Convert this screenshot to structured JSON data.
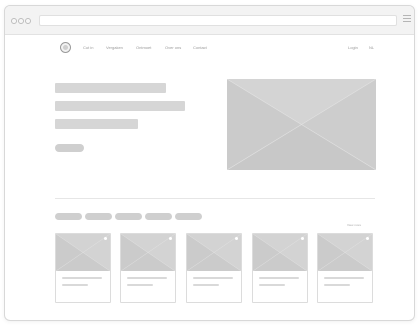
{
  "nav": {
    "items": [
      "Cut in",
      "Vergaken",
      "Ontmoet",
      "Over ons",
      "Contact"
    ],
    "login_label": "Login",
    "lang_label": "NL"
  },
  "products": {
    "see_all_label": "View more"
  },
  "icons": {
    "logo": "circle-logo-icon",
    "menu": "hamburger-menu-icon",
    "image_placeholder": "image-placeholder-icon"
  },
  "colors": {
    "placeholder": "#d4d4d4",
    "text_muted": "#9a9a9a",
    "border": "#d8d8d8"
  }
}
